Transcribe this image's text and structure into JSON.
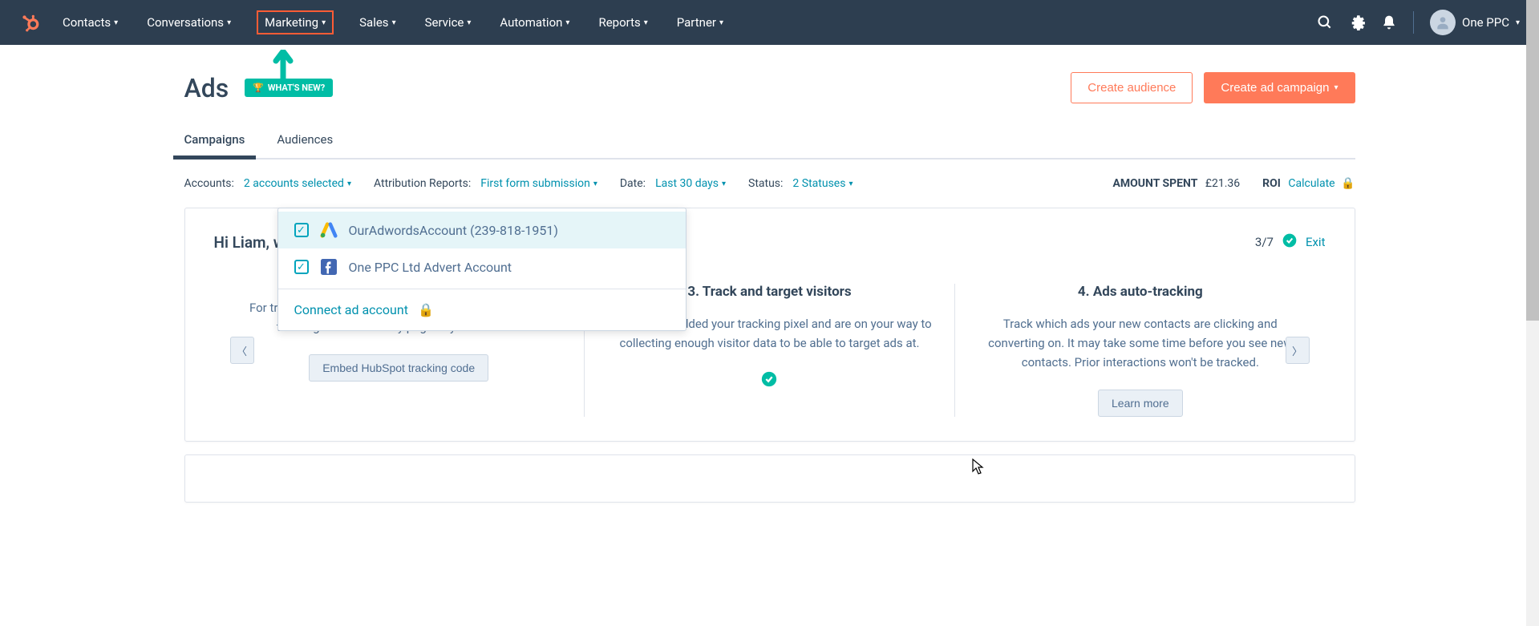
{
  "nav": {
    "items": [
      "Contacts",
      "Conversations",
      "Marketing",
      "Sales",
      "Service",
      "Automation",
      "Reports",
      "Partner"
    ],
    "highlighted_index": 2,
    "account_label": "One PPC"
  },
  "page": {
    "title": "Ads",
    "whats_new": "WHAT'S NEW?",
    "create_audience": "Create audience",
    "create_campaign": "Create ad campaign"
  },
  "tabs": [
    {
      "label": "Campaigns",
      "active": true
    },
    {
      "label": "Audiences",
      "active": false
    }
  ],
  "filters": {
    "accounts_label": "Accounts:",
    "accounts_value": "2 accounts selected",
    "attribution_label": "Attribution Reports:",
    "attribution_value": "First form submission",
    "date_label": "Date:",
    "date_value": "Last 30 days",
    "status_label": "Status:",
    "status_value": "2 Statuses"
  },
  "metrics": {
    "spent_label": "AMOUNT SPENT",
    "spent_value": "£21.36",
    "roi_label": "ROI",
    "roi_action": "Calculate"
  },
  "accounts_dropdown": {
    "items": [
      {
        "name": "OurAdwordsAccount (239-818-1951)",
        "provider": "google",
        "checked": true,
        "hovered": true
      },
      {
        "name": "One PPC Ltd Advert Account",
        "provider": "facebook",
        "checked": true,
        "hovered": false
      }
    ],
    "connect_label": "Connect ad account"
  },
  "intro": {
    "greeting_prefix": "Hi Liam, wel",
    "progress": "3/7",
    "exit": "Exit",
    "steps": [
      {
        "title": "",
        "desc": "For tracking to work, make sure you embed the HubSpot tracking code into every page of your website.",
        "action": "Embed HubSpot tracking code",
        "action_type": "button"
      },
      {
        "title": "3. Track and target visitors",
        "desc": "Nice! You've added your tracking pixel and are on your way to collecting enough visitor data to be able to target ads at.",
        "action_type": "check"
      },
      {
        "title": "4. Ads auto-tracking",
        "desc": "Track which ads your new contacts are clicking and converting on. It may take some time before you see new contacts. Prior interactions won't be tracked.",
        "action": "Learn more",
        "action_type": "button"
      }
    ]
  }
}
